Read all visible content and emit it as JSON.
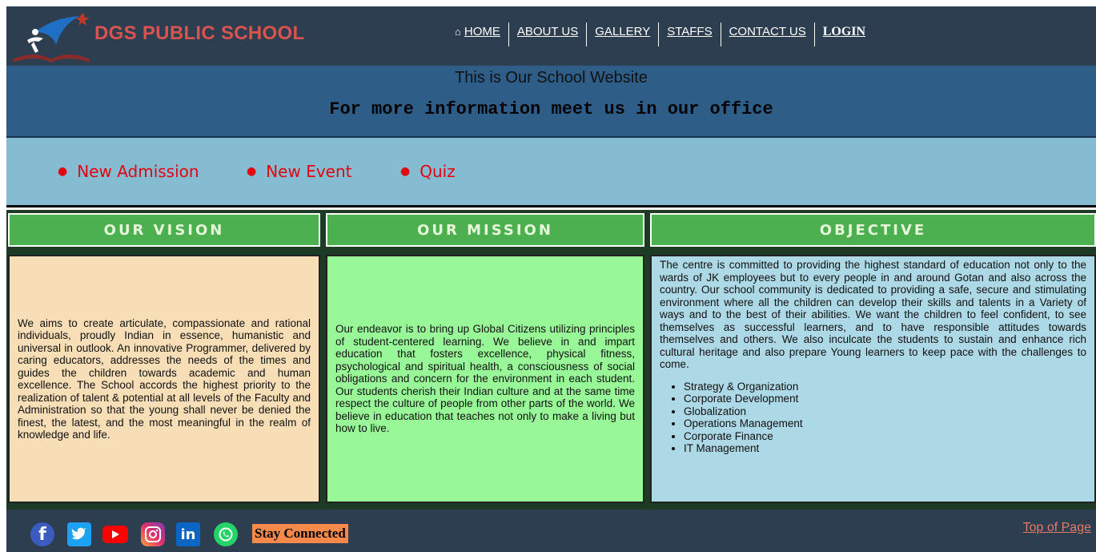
{
  "header": {
    "school_name": "DGS PUBLIC SCHOOL",
    "nav": [
      {
        "label": "HOME",
        "icon": "home-icon"
      },
      {
        "label": "ABOUT US"
      },
      {
        "label": "GALLERY"
      },
      {
        "label": "STAFFS"
      },
      {
        "label": "CONTACT US"
      },
      {
        "label": "LOGIN"
      }
    ]
  },
  "banner": {
    "title": "This is Our School Website",
    "subtitle": "For more information meet us in our office"
  },
  "notices": [
    "New Admission",
    "New Event",
    "Quiz"
  ],
  "sections": {
    "vision": {
      "heading": "OUR VISION",
      "text": "We aims to create articulate, compassionate and rational individuals, proudly Indian in essence, humanistic and universal in outlook. An innovative Programmer, delivered by caring educators, addresses the needs of the times and guides the children towards academic and human excellence. The School accords the highest priority to the realization of talent & potential at all levels of the Faculty and Administration so that the young shall never be denied the finest, the latest, and the most meaningful in the realm of knowledge and life."
    },
    "mission": {
      "heading": "OUR MISSION",
      "text": "Our endeavor is to bring up Global Citizens utilizing principles of student-centered learning. We believe in and impart education that fosters excellence, physical fitness, psychological and spiritual health, a consciousness of social obligations and concern for the environment in each student. Our students cherish their Indian culture and at the same time respect the culture of people from other parts of the world. We believe in education that teaches not only to make a living but how to live."
    },
    "objective": {
      "heading": "OBJECTIVE",
      "text": "The centre is committed to providing the highest standard of education not only to the wards of JK employees but to every people in and around Gotan and also across the country. Our school community is dedicated to providing a safe, secure and stimulating environment where all the children can develop their skills and talents in a Variety of ways and to the best of their abilities. We want the children to feel confident, to see themselves as successful learners, and to have responsible attitudes towards themselves and others. We also inculcate the students to sustain and enhance rich cultural heritage and also prepare Young learners to keep pace with the challenges to come.",
      "items": [
        "Strategy & Organization",
        "Corporate Development",
        "Globalization",
        "Operations Management",
        "Corporate Finance",
        "IT Management"
      ]
    }
  },
  "footer": {
    "social_icons": [
      "facebook-icon",
      "twitter-icon",
      "youtube-icon",
      "instagram-icon",
      "linkedin-icon",
      "whatsapp-icon"
    ],
    "stay_connected": "Stay Connected",
    "top_link": "Top of Page"
  },
  "colors": {
    "header_bg": "#2c3e50",
    "brand_red": "#d9534f",
    "banner_bg": "#2e5d87",
    "notice_bg": "#85bcd1",
    "notice_text": "#e0000f",
    "heading_green": "#4caf50",
    "vision_bg": "#f8deb6",
    "mission_bg": "#98f898",
    "objective_bg": "#add8e6",
    "stay_bg": "#f7894a"
  }
}
